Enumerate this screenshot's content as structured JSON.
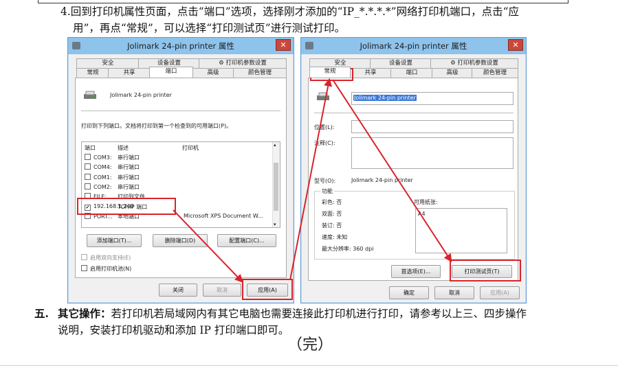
{
  "doc": {
    "step4_line1": "4.回到打印机属性页面，点击“端口”选项，选择刚才添加的“IP_*.*.*.*”网络打印机端口，点击“应",
    "step4_line2": "用”，再点“常规”，可以选择“打印测试页”进行测试打印。",
    "section5_label": "五.",
    "section5_bold": "其它操作：",
    "section5_line1": "若打印机若局域网内有其它电脑也需要连接此打印机进行打印，请参考以上三、四步操作",
    "section5_line2": "说明，安装打印机驱动和添加 IP 打印端口即可。",
    "end_mark": "（完）"
  },
  "dialog_left": {
    "title": "Jolimark 24-pin printer 属性",
    "close": "✕",
    "tabs_row1": [
      "安全",
      "设备设置",
      "打印机参数设置"
    ],
    "tabs_row2": [
      "常规",
      "共享",
      "端口",
      "高级",
      "颜色管理"
    ],
    "printer_name": "Jolimark 24-pin printer",
    "instruction": "打印到下列端口。文档将打印到第一个检查到的可用端口(P)。",
    "columns": [
      "端口",
      "描述",
      "打印机"
    ],
    "ports": [
      {
        "port": "COM3:",
        "desc": "串行端口",
        "printer": "",
        "checked": false
      },
      {
        "port": "COM4:",
        "desc": "串行端口",
        "printer": "",
        "checked": false
      },
      {
        "port": "COM1:",
        "desc": "串行端口",
        "printer": "",
        "checked": false
      },
      {
        "port": "COM2:",
        "desc": "串行端口",
        "printer": "",
        "checked": false
      },
      {
        "port": "FILE:",
        "desc": "打印到文件",
        "printer": "",
        "checked": false
      },
      {
        "port": "192.168.1.240",
        "desc": "TCP/IP 端口",
        "printer": "",
        "checked": true
      },
      {
        "port": "PORT...",
        "desc": "本地端口",
        "printer": "Microsoft XPS Document W...",
        "checked": false
      }
    ],
    "add_port": "添加端口(T)...",
    "delete_port": "删除端口(D)",
    "config_port": "配置端口(C)...",
    "bidirectional": "启用双向支持(E)",
    "pooling": "启用打印机池(N)",
    "close_btn": "关闭",
    "cancel_btn": "取消",
    "apply_btn": "应用(A)"
  },
  "dialog_right": {
    "title": "Jolimark 24-pin printer 属性",
    "close": "✕",
    "tabs_row1": [
      "安全",
      "设备设置",
      "打印机参数设置"
    ],
    "tabs_row2": [
      "常规",
      "共享",
      "端口",
      "高级",
      "颜色管理"
    ],
    "printer_name": "Jolimark 24-pin printer",
    "location_label": "位置(L):",
    "comment_label": "注释(C):",
    "model_label": "型号(O):",
    "model_value": "Jolimark 24-pin printer",
    "features_label": "功能",
    "color": "彩色: 否",
    "duplex": "双面: 否",
    "staple": "装订: 否",
    "speed": "速度: 未知",
    "resolution": "最大分辨率: 360 dpi",
    "paper_label": "可用纸张:",
    "paper_value": "A4",
    "preferences_btn": "首选项(E)...",
    "test_page_btn": "打印测试页(T)",
    "ok_btn": "确定",
    "cancel_btn": "取消",
    "apply_btn": "应用(A)"
  },
  "colors": {
    "accent_red": "#d9232a",
    "titlebar": "#8ec3ec",
    "close_red": "#c9483c"
  }
}
